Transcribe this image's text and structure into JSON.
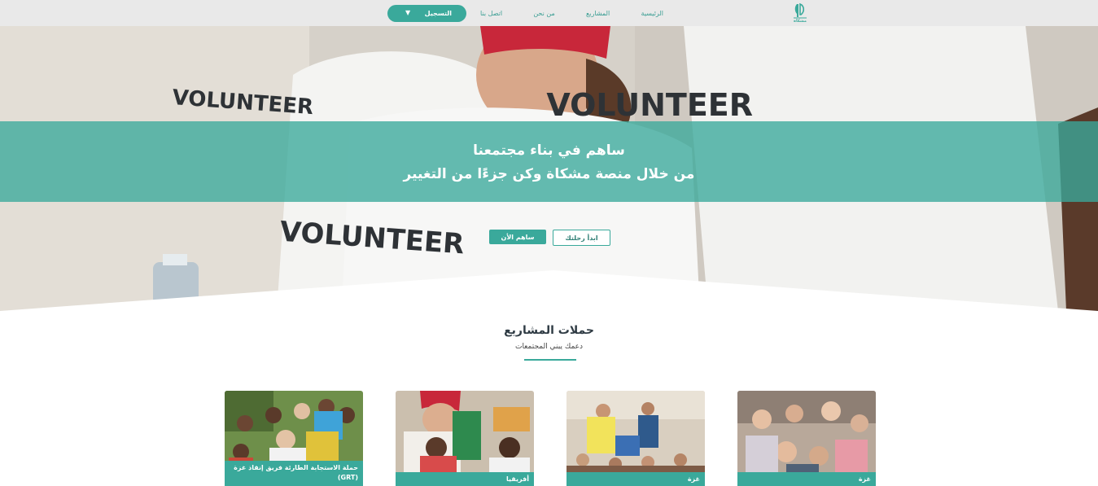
{
  "nav": {
    "logo_text": "مشكاة",
    "links": [
      "الرئيسية",
      "المشاريع",
      "من نحن",
      "اتصل بنا"
    ],
    "register_label": "التسجيل"
  },
  "hero": {
    "shirt_text": "VOLUNTEER",
    "line1": "ساهم في بناء مجتمعنا",
    "line2": "من خلال منصة مشكاة وكن جزءًا من التغيير",
    "start_button": "ابدأ رحلتك",
    "contribute_button": "ساهم الأن"
  },
  "section": {
    "title": "حملات المشاريع",
    "subtitle": "دعمك يبني المجتمعات"
  },
  "cards": [
    {
      "label": "غزة"
    },
    {
      "label": "غزة"
    },
    {
      "label": "أفريقيا"
    },
    {
      "label": "حملة الاستجابة الطارئة فريق إنقاذ غزة (GRT)"
    }
  ],
  "colors": {
    "accent": "#3aa99b",
    "navbar_bg": "#e9e9e9"
  }
}
